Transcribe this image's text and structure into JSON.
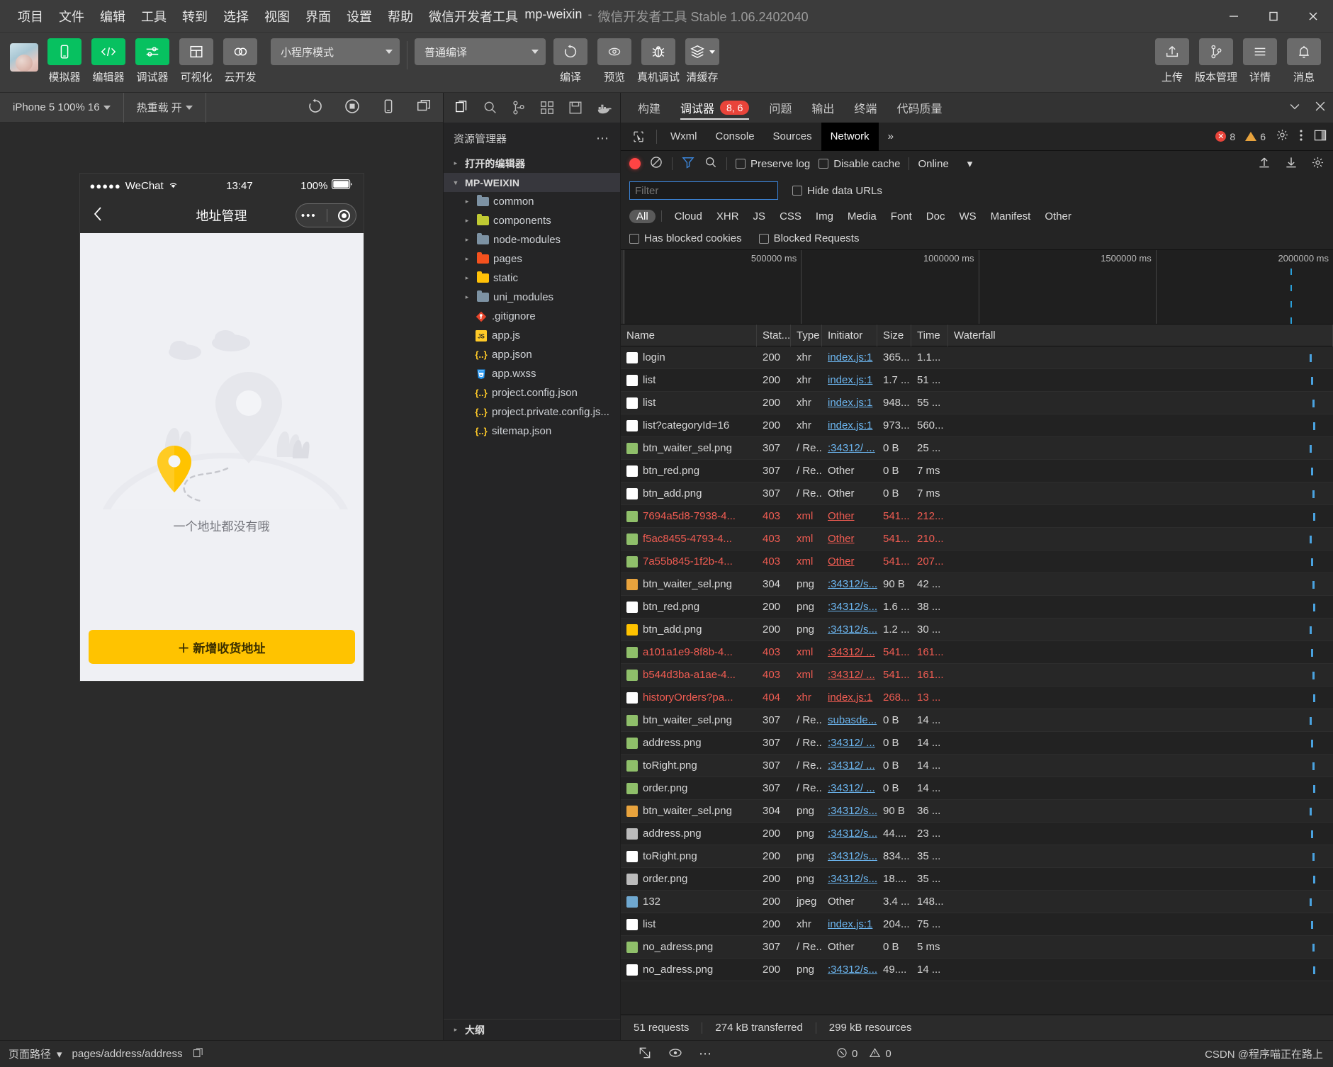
{
  "titlebar": {
    "menus": [
      "项目",
      "文件",
      "编辑",
      "工具",
      "转到",
      "选择",
      "视图",
      "界面",
      "设置",
      "帮助",
      "微信开发者工具"
    ],
    "project_name": "mp-weixin",
    "dash": "-",
    "app_subtitle": "微信开发者工具 Stable 1.06.2402040",
    "minimize": "—",
    "maximize": "□",
    "close": "✕"
  },
  "toolbar": {
    "items": [
      {
        "label": "模拟器",
        "icon": "phone-icon",
        "style": "green"
      },
      {
        "label": "编辑器",
        "icon": "code-icon",
        "style": "green"
      },
      {
        "label": "调试器",
        "icon": "debug-slider-icon",
        "style": "green"
      },
      {
        "label": "可视化",
        "icon": "layout-icon",
        "style": "grey"
      },
      {
        "label": "云开发",
        "icon": "cloud-icon",
        "style": "grey"
      }
    ],
    "mode_select": "小程序模式",
    "compile_select": "普通编译",
    "actions": [
      {
        "label": "编译",
        "icon": "refresh-icon"
      },
      {
        "label": "预览",
        "icon": "eye-icon"
      },
      {
        "label": "真机调试",
        "icon": "bug-icon"
      },
      {
        "label": "清缓存",
        "icon": "layers-icon"
      }
    ],
    "right_actions": [
      {
        "label": "上传",
        "icon": "upload-icon"
      },
      {
        "label": "版本管理",
        "icon": "git-branch-icon"
      },
      {
        "label": "详情",
        "icon": "menu-lines-icon"
      },
      {
        "label": "消息",
        "icon": "bell-icon"
      }
    ]
  },
  "simulator": {
    "device_select": "iPhone 5 100% 16",
    "hotreload_select": "热重载 开",
    "refresh_icon": "refresh-icon",
    "stop_icon": "stop-record-icon",
    "rotate_icon": "rotate-device-icon",
    "multi_icon": "multi-window-icon",
    "phone": {
      "carrier_dots": "●●●●●",
      "carrier": "WeChat",
      "wifi": "wifi-icon",
      "time": "13:47",
      "battery_pct": "100%",
      "back_icon": "chevron-left-icon",
      "title": "地址管理",
      "capsule_dots": "•••",
      "empty_text": "一个地址都没有哦",
      "add_button": "＋ 新增收货地址"
    }
  },
  "explorer": {
    "actions": [
      {
        "icon": "files-icon",
        "active": true
      },
      {
        "icon": "search-icon",
        "active": false
      },
      {
        "icon": "source-control-icon",
        "active": false
      },
      {
        "icon": "extensions-icon",
        "active": false
      },
      {
        "icon": "save-all-icon",
        "active": false
      },
      {
        "icon": "docker-icon",
        "active": false
      }
    ],
    "title": "资源管理器",
    "more_icon": "more-horizontal-icon",
    "sections": [
      {
        "label": "打开的编辑器",
        "expanded": false
      },
      {
        "label": "MP-WEIXIN",
        "expanded": true
      }
    ],
    "tree": [
      {
        "name": "common",
        "type": "folder",
        "color": "#7d92a3",
        "arrow": "▸"
      },
      {
        "name": "components",
        "type": "folder",
        "color": "#c0ca33",
        "arrow": "▸"
      },
      {
        "name": "node-modules",
        "type": "folder",
        "color": "#7d92a3",
        "arrow": "▸"
      },
      {
        "name": "pages",
        "type": "folder",
        "color": "#f4511e",
        "arrow": "▸"
      },
      {
        "name": "static",
        "type": "folder",
        "color": "#ffc107",
        "arrow": "▸"
      },
      {
        "name": "uni_modules",
        "type": "folder",
        "color": "#7d92a3",
        "arrow": "▸"
      },
      {
        "name": ".gitignore",
        "type": "file",
        "icon": "git-icon",
        "color": "#e8452b"
      },
      {
        "name": "app.js",
        "type": "file",
        "icon": "js-icon",
        "color": "#ffca28"
      },
      {
        "name": "app.json",
        "type": "file",
        "icon": "json-icon",
        "color": "#ffca28"
      },
      {
        "name": "app.wxss",
        "type": "file",
        "icon": "css-icon",
        "color": "#2196f3"
      },
      {
        "name": "project.config.json",
        "type": "file",
        "icon": "json-icon",
        "color": "#ffca28"
      },
      {
        "name": "project.private.config.js...",
        "type": "file",
        "icon": "json-icon",
        "color": "#ffca28"
      },
      {
        "name": "sitemap.json",
        "type": "file",
        "icon": "json-icon",
        "color": "#ffca28"
      }
    ],
    "outline": "大纲",
    "outline_arrow": "▸"
  },
  "devtools": {
    "tabs": [
      {
        "label": "构建",
        "active": false,
        "badge": null
      },
      {
        "label": "调试器",
        "active": true,
        "badge": "8, 6"
      },
      {
        "label": "问题",
        "active": false,
        "badge": null
      },
      {
        "label": "输出",
        "active": false,
        "badge": null
      },
      {
        "label": "终端",
        "active": false,
        "badge": null
      },
      {
        "label": "代码质量",
        "active": false,
        "badge": null
      }
    ],
    "collapse_icon": "chevron-down-icon",
    "close_icon": "close-icon",
    "panel_tabs": [
      {
        "label": "Wxml",
        "active": false
      },
      {
        "label": "Console",
        "active": false
      },
      {
        "label": "Sources",
        "active": false
      },
      {
        "label": "Network",
        "active": true
      }
    ],
    "inspect_icon": "inspect-cursor-icon",
    "overflow": "»",
    "error_count": "8",
    "warning_count": "6",
    "settings_icon": "gear-icon",
    "kebab_icon": "more-vertical-icon",
    "dock_icon": "dock-panel-icon",
    "network": {
      "record_icon": "record-icon",
      "clear_icon": "clear-icon",
      "filter_icon": "filter-funnel-icon",
      "search_icon": "search-icon",
      "preserve_log": "Preserve log",
      "disable_cache": "Disable cache",
      "throttle": "Online",
      "throttle_caret": "▾",
      "import_icon": "upload-har-icon",
      "export_icon": "download-har-icon",
      "net_settings_icon": "gear-icon",
      "filter_placeholder": "Filter",
      "hide_data_urls": "Hide data URLs",
      "types": [
        "All",
        "Cloud",
        "XHR",
        "JS",
        "CSS",
        "Img",
        "Media",
        "Font",
        "Doc",
        "WS",
        "Manifest",
        "Other"
      ],
      "active_type": "All",
      "has_blocked_cookies": "Has blocked cookies",
      "blocked_requests": "Blocked Requests",
      "timeline_labels": [
        "500000 ms",
        "1000000 ms",
        "1500000 ms",
        "2000000 ms"
      ],
      "columns": [
        "Name",
        "Stat...",
        "Type",
        "Initiator",
        "Size",
        "Time",
        "Waterfall"
      ],
      "rows": [
        {
          "name": "login",
          "status": "200",
          "type": "xhr",
          "initiator": "index.js:1",
          "size": "365...",
          "time": "1.1...",
          "err": false,
          "ico": "#ffffff",
          "link": true
        },
        {
          "name": "list",
          "status": "200",
          "type": "xhr",
          "initiator": "index.js:1",
          "size": "1.7 ...",
          "time": "51 ...",
          "err": false,
          "ico": "#ffffff",
          "link": true
        },
        {
          "name": "list",
          "status": "200",
          "type": "xhr",
          "initiator": "index.js:1",
          "size": "948...",
          "time": "55 ...",
          "err": false,
          "ico": "#ffffff",
          "link": true
        },
        {
          "name": "list?categoryId=16",
          "status": "200",
          "type": "xhr",
          "initiator": "index.js:1",
          "size": "973...",
          "time": "560...",
          "err": false,
          "ico": "#ffffff",
          "link": true
        },
        {
          "name": "btn_waiter_sel.png",
          "status": "307",
          "type": "/ Re...",
          "initiator": ":34312/ ...",
          "size": "0 B",
          "time": "25 ...",
          "err": false,
          "ico": "#8fbf6a",
          "link": true
        },
        {
          "name": "btn_red.png",
          "status": "307",
          "type": "/ Re...",
          "initiator": "Other",
          "size": "0 B",
          "time": "7 ms",
          "err": false,
          "ico": "#ffffff",
          "link": false
        },
        {
          "name": "btn_add.png",
          "status": "307",
          "type": "/ Re...",
          "initiator": "Other",
          "size": "0 B",
          "time": "7 ms",
          "err": false,
          "ico": "#ffffff",
          "link": false
        },
        {
          "name": "7694a5d8-7938-4...",
          "status": "403",
          "type": "xml",
          "initiator": "Other",
          "size": "541...",
          "time": "212...",
          "err": true,
          "ico": "#8fbf6a",
          "link": false
        },
        {
          "name": "f5ac8455-4793-4...",
          "status": "403",
          "type": "xml",
          "initiator": "Other",
          "size": "541...",
          "time": "210...",
          "err": true,
          "ico": "#8fbf6a",
          "link": false
        },
        {
          "name": "7a55b845-1f2b-4...",
          "status": "403",
          "type": "xml",
          "initiator": "Other",
          "size": "541...",
          "time": "207...",
          "err": true,
          "ico": "#8fbf6a",
          "link": false
        },
        {
          "name": "btn_waiter_sel.png",
          "status": "304",
          "type": "png",
          "initiator": ":34312/s...",
          "size": "90 B",
          "time": "42 ...",
          "err": false,
          "ico": "#e8a33d",
          "link": true
        },
        {
          "name": "btn_red.png",
          "status": "200",
          "type": "png",
          "initiator": ":34312/s...",
          "size": "1.6 ...",
          "time": "38 ...",
          "err": false,
          "ico": "#ffffff",
          "link": true
        },
        {
          "name": "btn_add.png",
          "status": "200",
          "type": "png",
          "initiator": ":34312/s...",
          "size": "1.2 ...",
          "time": "30 ...",
          "err": false,
          "ico": "#ffc300",
          "link": true
        },
        {
          "name": "a101a1e9-8f8b-4...",
          "status": "403",
          "type": "xml",
          "initiator": ":34312/ ...",
          "size": "541...",
          "time": "161...",
          "err": true,
          "ico": "#8fbf6a",
          "link": true
        },
        {
          "name": "b544d3ba-a1ae-4...",
          "status": "403",
          "type": "xml",
          "initiator": ":34312/ ...",
          "size": "541...",
          "time": "161...",
          "err": true,
          "ico": "#8fbf6a",
          "link": true
        },
        {
          "name": "historyOrders?pa...",
          "status": "404",
          "type": "xhr",
          "initiator": "index.js:1",
          "size": "268...",
          "time": "13 ...",
          "err": true,
          "ico": "#ffffff",
          "link": true
        },
        {
          "name": "btn_waiter_sel.png",
          "status": "307",
          "type": "/ Re...",
          "initiator": "subasde...",
          "size": "0 B",
          "time": "14 ...",
          "err": false,
          "ico": "#8fbf6a",
          "link": true
        },
        {
          "name": "address.png",
          "status": "307",
          "type": "/ Re...",
          "initiator": ":34312/ ...",
          "size": "0 B",
          "time": "14 ...",
          "err": false,
          "ico": "#8fbf6a",
          "link": true
        },
        {
          "name": "toRight.png",
          "status": "307",
          "type": "/ Re...",
          "initiator": ":34312/ ...",
          "size": "0 B",
          "time": "14 ...",
          "err": false,
          "ico": "#8fbf6a",
          "link": true
        },
        {
          "name": "order.png",
          "status": "307",
          "type": "/ Re...",
          "initiator": ":34312/ ...",
          "size": "0 B",
          "time": "14 ...",
          "err": false,
          "ico": "#8fbf6a",
          "link": true
        },
        {
          "name": "btn_waiter_sel.png",
          "status": "304",
          "type": "png",
          "initiator": ":34312/s...",
          "size": "90 B",
          "time": "36 ...",
          "err": false,
          "ico": "#e8a33d",
          "link": true
        },
        {
          "name": "address.png",
          "status": "200",
          "type": "png",
          "initiator": ":34312/s...",
          "size": "44....",
          "time": "23 ...",
          "err": false,
          "ico": "#bbbbbb",
          "link": true
        },
        {
          "name": "toRight.png",
          "status": "200",
          "type": "png",
          "initiator": ":34312/s...",
          "size": "834...",
          "time": "35 ...",
          "err": false,
          "ico": "#ffffff",
          "link": true
        },
        {
          "name": "order.png",
          "status": "200",
          "type": "png",
          "initiator": ":34312/s...",
          "size": "18....",
          "time": "35 ...",
          "err": false,
          "ico": "#bbbbbb",
          "link": true
        },
        {
          "name": "132",
          "status": "200",
          "type": "jpeg",
          "initiator": "Other",
          "size": "3.4 ...",
          "time": "148...",
          "err": false,
          "ico": "#6fa8d0",
          "link": false
        },
        {
          "name": "list",
          "status": "200",
          "type": "xhr",
          "initiator": "index.js:1",
          "size": "204...",
          "time": "75 ...",
          "err": false,
          "ico": "#ffffff",
          "link": true
        },
        {
          "name": "no_adress.png",
          "status": "307",
          "type": "/ Re...",
          "initiator": "Other",
          "size": "0 B",
          "time": "5 ms",
          "err": false,
          "ico": "#8fbf6a",
          "link": false
        },
        {
          "name": "no_adress.png",
          "status": "200",
          "type": "png",
          "initiator": ":34312/s...",
          "size": "49....",
          "time": "14 ...",
          "err": false,
          "ico": "#ffffff",
          "link": true
        }
      ],
      "summary": [
        "51 requests",
        "274 kB transferred",
        "299 kB resources"
      ]
    }
  },
  "statusbar": {
    "path_label": "页面路径",
    "path_caret": "▾",
    "path_value": "pages/address/address",
    "copy_icon": "copy-icon",
    "scale_icon": "scale-icon",
    "eye_icon": "eye-icon",
    "more_icon": "more-horizontal-icon",
    "error_icon": "error-circle-icon",
    "error_count": "0",
    "warning_icon": "warning-triangle-icon",
    "warning_count": "0",
    "watermark": "CSDN @程序喵正在路上"
  }
}
